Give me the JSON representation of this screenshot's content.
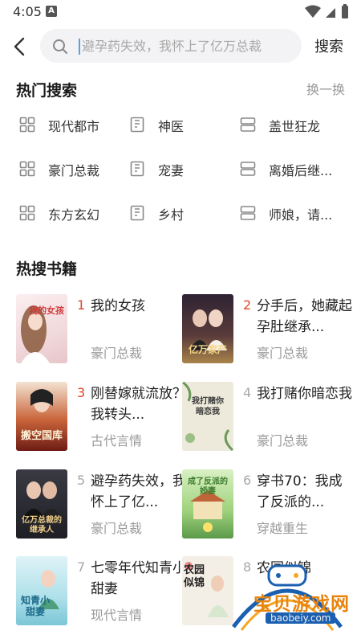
{
  "status_bar": {
    "time": "4:05",
    "app_badge": "A"
  },
  "search": {
    "placeholder": "避孕药失效，我怀上了亿万总裁",
    "button_label": "搜索"
  },
  "hot_search": {
    "title": "热门搜索",
    "refresh_label": "换一换",
    "items": [
      {
        "label": "现代都市",
        "icon": "grid-icon"
      },
      {
        "label": "神医",
        "icon": "book-icon"
      },
      {
        "label": "盖世狂龙",
        "icon": "stack-icon"
      },
      {
        "label": "豪门总裁",
        "icon": "grid-icon"
      },
      {
        "label": "宠妻",
        "icon": "book-icon"
      },
      {
        "label": "离婚后继...",
        "icon": "stack-icon"
      },
      {
        "label": "东方玄幻",
        "icon": "grid-icon"
      },
      {
        "label": "乡村",
        "icon": "book-icon"
      },
      {
        "label": "师娘，请...",
        "icon": "stack-icon"
      }
    ]
  },
  "hot_books": {
    "title": "热搜书籍",
    "books": [
      {
        "rank": "1",
        "title": "我的女孩",
        "genre": "豪门总裁",
        "cover_text": "我的女孩",
        "cover_color": "#f5e6e6"
      },
      {
        "rank": "2",
        "title": "分手后，她藏起孕肚继承...",
        "genre": "豪门总裁",
        "cover_text": "亿万家产",
        "cover_color": "#3b2a3a"
      },
      {
        "rank": "3",
        "title": "刚替嫁就流放？我转头...",
        "genre": "古代言情",
        "cover_text": "搬空国库",
        "cover_color": "#8a2a1e"
      },
      {
        "rank": "4",
        "title": "我打赌你暗恋我",
        "genre": "豪门总裁",
        "cover_text": "我打赌你暗恋我",
        "cover_color": "#eeeadb"
      },
      {
        "rank": "5",
        "title": "避孕药失效，我怀上了亿...",
        "genre": "豪门总裁",
        "cover_text": "亿万总裁的继承人",
        "cover_color": "#2a2a30"
      },
      {
        "rank": "6",
        "title": "穿书70：我成了反派的...",
        "genre": "穿越重生",
        "cover_text": "成了反派的娇妻",
        "cover_color": "#cfe8b0"
      },
      {
        "rank": "7",
        "title": "七零年代知青小甜妻",
        "genre": "现代言情",
        "cover_text": "知青小甜妻",
        "cover_color": "#b9e3ec"
      },
      {
        "rank": "8",
        "title": "农园似锦",
        "genre": "",
        "cover_text": "农园似锦",
        "cover_color": "#f4efe6"
      }
    ]
  },
  "watermark": {
    "text": "宝贝游戏网",
    "url": "baobeiy.com"
  },
  "colors": {
    "rank_hot": "#e0462a",
    "rank_normal": "#a8a8a8",
    "accent": "#5aa0e8"
  }
}
